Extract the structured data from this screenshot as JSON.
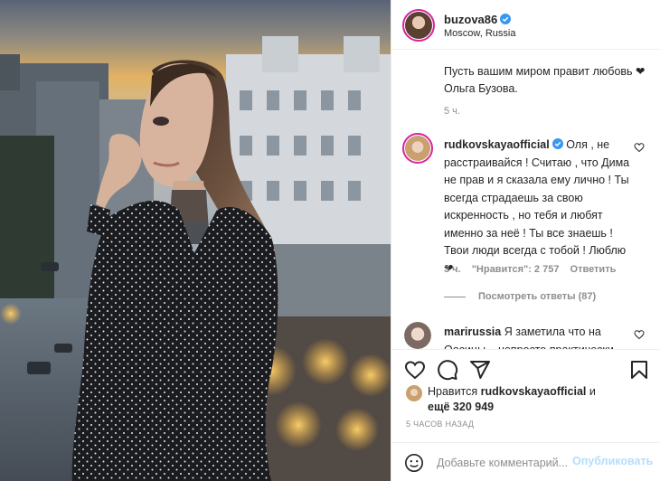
{
  "header": {
    "username": "buzova86",
    "location": "Moscow, Russia"
  },
  "caption": {
    "text": "Пусть вашим миром правит любовь ❤ Ольга Бузова.",
    "time": "5 ч."
  },
  "comments": [
    {
      "username": "rudkovskayaofficial",
      "text": "Оля , не расстраивайся ! Считаю , что Дима не прав и я сказала ему лично ! Ты всегда страдаешь за свою искренность , но тебя и любят именно за неё ! Ты все знаешь ! Твои люди всегда с тобой ! Люблю ❤",
      "time": "3 ч.",
      "likes": "\"Нравится\": 2 757",
      "reply": "Ответить",
      "view_replies": "Посмотреть ответы (87)"
    },
    {
      "username": "marirussia",
      "text": "Я заметила что на Оосицы .. непросто практически"
    }
  ],
  "likes": {
    "prefix": "Нравится",
    "user": "rudkovskayaofficial",
    "middle": "и",
    "suffix": "ещё 320 949"
  },
  "time_ago": "5 ЧАСОВ НАЗАД",
  "add_comment": {
    "placeholder": "Добавьте комментарий...",
    "publish": "Опубликовать"
  },
  "colors": {
    "accent": "#0095f6",
    "verified": "#3897f0",
    "muted": "#8e8e8e",
    "border": "#efefef",
    "publish_disabled": "#b2dffc"
  },
  "icons": [
    "heart-icon",
    "comment-icon",
    "share-icon",
    "bookmark-icon",
    "emoji-icon",
    "verified-icon"
  ]
}
